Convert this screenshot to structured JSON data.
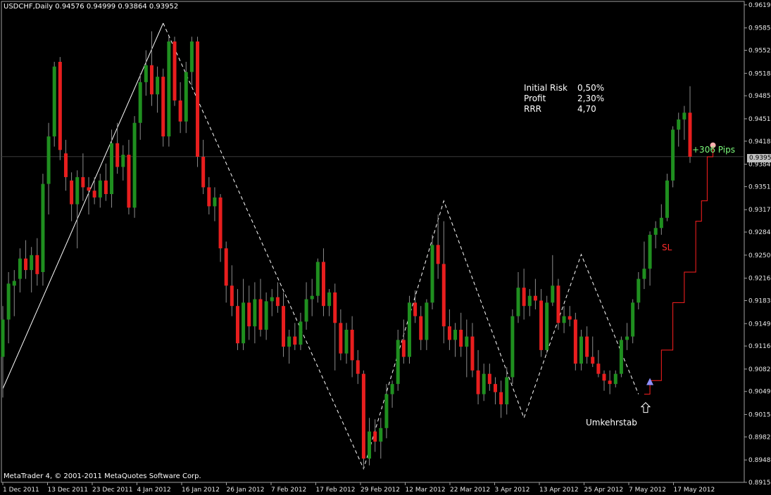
{
  "header": {
    "symbol_line": "USDCHF,Daily  0.94576 0.94999 0.93864 0.93952"
  },
  "footer": {
    "copyright": "MetaTrader 4, © 2001-2011 MetaQuotes Software Corp."
  },
  "stats": [
    {
      "label": "Initial Risk",
      "value": "0,50%"
    },
    {
      "label": "Profit",
      "value": "2,30%"
    },
    {
      "label": "RRR",
      "value": "4,70"
    }
  ],
  "annotations": {
    "pips": "+306 Pips",
    "sl": "SL",
    "reversal": "Umkehrstab"
  },
  "current_price": "0.93952",
  "colors": {
    "bull": "#1f8f1f",
    "bear": "#e81e1e",
    "wick": "#8c8c8c",
    "zigzag": "#ffffff",
    "sl_line": "#ff2020",
    "axis": "#a0a0a0"
  },
  "chart_data": {
    "type": "candlestick",
    "ylim": [
      0.8915,
      0.9622
    ],
    "y_ticks": [
      "0.96190",
      "0.95850",
      "0.95520",
      "0.95180",
      "0.94850",
      "0.94510",
      "0.94180",
      "0.93840",
      "0.93510",
      "0.93170",
      "0.92840",
      "0.92500",
      "0.92160",
      "0.91830",
      "0.91490",
      "0.91160",
      "0.90820",
      "0.90490",
      "0.90150",
      "0.89820",
      "0.89480",
      "0.89150"
    ],
    "x_ticks": [
      "1 Dec 2011",
      "13 Dec 2011",
      "23 Dec 2011",
      "4 Jan 2012",
      "16 Jan 2012",
      "26 Jan 2012",
      "7 Feb 2012",
      "17 Feb 2012",
      "29 Feb 2012",
      "12 Mar 2012",
      "22 Mar 2012",
      "3 Apr 2012",
      "13 Apr 2012",
      "25 Apr 2012",
      "7 May 2012",
      "17 May 2012"
    ],
    "candles": [
      [
        0.91,
        0.9175,
        0.904,
        0.9155
      ],
      [
        0.9155,
        0.9225,
        0.912,
        0.9208
      ],
      [
        0.9205,
        0.9228,
        0.916,
        0.9212
      ],
      [
        0.9215,
        0.926,
        0.9195,
        0.9245
      ],
      [
        0.9245,
        0.9272,
        0.9215,
        0.9228
      ],
      [
        0.9228,
        0.9262,
        0.9195,
        0.925
      ],
      [
        0.925,
        0.9275,
        0.9205,
        0.9222
      ],
      [
        0.9225,
        0.937,
        0.9205,
        0.9355
      ],
      [
        0.9355,
        0.9445,
        0.931,
        0.9425
      ],
      [
        0.9425,
        0.9535,
        0.941,
        0.9528
      ],
      [
        0.9535,
        0.9542,
        0.939,
        0.9405
      ],
      [
        0.94,
        0.942,
        0.9345,
        0.9365
      ],
      [
        0.936,
        0.9372,
        0.93,
        0.9325
      ],
      [
        0.9325,
        0.9375,
        0.926,
        0.9365
      ],
      [
        0.9365,
        0.94,
        0.933,
        0.935
      ],
      [
        0.935,
        0.9365,
        0.931,
        0.9345
      ],
      [
        0.9345,
        0.9365,
        0.9325,
        0.9335
      ],
      [
        0.9335,
        0.937,
        0.932,
        0.936
      ],
      [
        0.936,
        0.9385,
        0.933,
        0.934
      ],
      [
        0.934,
        0.9435,
        0.932,
        0.9415
      ],
      [
        0.9415,
        0.9445,
        0.937,
        0.938
      ],
      [
        0.938,
        0.9412,
        0.936,
        0.9398
      ],
      [
        0.9398,
        0.942,
        0.931,
        0.932
      ],
      [
        0.932,
        0.9455,
        0.9305,
        0.9445
      ],
      [
        0.9445,
        0.9518,
        0.942,
        0.9505
      ],
      [
        0.9505,
        0.9552,
        0.9485,
        0.953
      ],
      [
        0.953,
        0.958,
        0.947,
        0.9487
      ],
      [
        0.9487,
        0.9528,
        0.946,
        0.9513
      ],
      [
        0.9513,
        0.9525,
        0.941,
        0.9425
      ],
      [
        0.9425,
        0.9572,
        0.941,
        0.9565
      ],
      [
        0.9565,
        0.9572,
        0.947,
        0.9478
      ],
      [
        0.9478,
        0.9505,
        0.943,
        0.9447
      ],
      [
        0.9447,
        0.9535,
        0.943,
        0.952
      ],
      [
        0.952,
        0.9572,
        0.95,
        0.9565
      ],
      [
        0.9565,
        0.9572,
        0.938,
        0.9395
      ],
      [
        0.9395,
        0.942,
        0.934,
        0.935
      ],
      [
        0.935,
        0.9365,
        0.931,
        0.9322
      ],
      [
        0.9322,
        0.935,
        0.93,
        0.9335
      ],
      [
        0.9335,
        0.934,
        0.924,
        0.926
      ],
      [
        0.926,
        0.927,
        0.918,
        0.9205
      ],
      [
        0.9205,
        0.9235,
        0.916,
        0.9175
      ],
      [
        0.9175,
        0.92,
        0.911,
        0.912
      ],
      [
        0.912,
        0.9215,
        0.911,
        0.918
      ],
      [
        0.918,
        0.9205,
        0.9125,
        0.9145
      ],
      [
        0.9145,
        0.921,
        0.912,
        0.9185
      ],
      [
        0.9185,
        0.9215,
        0.913,
        0.914
      ],
      [
        0.914,
        0.9195,
        0.9125,
        0.9182
      ],
      [
        0.9182,
        0.92,
        0.916,
        0.9188
      ],
      [
        0.9188,
        0.921,
        0.9165,
        0.9175
      ],
      [
        0.9175,
        0.9195,
        0.91,
        0.9115
      ],
      [
        0.9115,
        0.914,
        0.909,
        0.913
      ],
      [
        0.913,
        0.915,
        0.911,
        0.9118
      ],
      [
        0.9118,
        0.9165,
        0.911,
        0.9152
      ],
      [
        0.9152,
        0.921,
        0.914,
        0.9185
      ],
      [
        0.9185,
        0.9215,
        0.916,
        0.919
      ],
      [
        0.919,
        0.9245,
        0.918,
        0.924
      ],
      [
        0.924,
        0.926,
        0.916,
        0.9175
      ],
      [
        0.9175,
        0.92,
        0.916,
        0.9195
      ],
      [
        0.9195,
        0.9208,
        0.908,
        0.915
      ],
      [
        0.915,
        0.917,
        0.9095,
        0.9105
      ],
      [
        0.9105,
        0.915,
        0.909,
        0.914
      ],
      [
        0.914,
        0.916,
        0.907,
        0.9095
      ],
      [
        0.9095,
        0.911,
        0.906,
        0.9075
      ],
      [
        0.9075,
        0.908,
        0.8935,
        0.895
      ],
      [
        0.895,
        0.901,
        0.894,
        0.899
      ],
      [
        0.899,
        0.9008,
        0.896,
        0.8975
      ],
      [
        0.8975,
        0.901,
        0.895,
        0.8995
      ],
      [
        0.8995,
        0.906,
        0.898,
        0.9045
      ],
      [
        0.9045,
        0.9065,
        0.9025,
        0.906
      ],
      [
        0.906,
        0.914,
        0.905,
        0.9125
      ],
      [
        0.9125,
        0.9155,
        0.909,
        0.91
      ],
      [
        0.91,
        0.919,
        0.909,
        0.918
      ],
      [
        0.918,
        0.9198,
        0.915,
        0.916
      ],
      [
        0.916,
        0.9175,
        0.911,
        0.9125
      ],
      [
        0.9125,
        0.9185,
        0.911,
        0.918
      ],
      [
        0.918,
        0.928,
        0.917,
        0.9265
      ],
      [
        0.9265,
        0.931,
        0.9215,
        0.9237
      ],
      [
        0.9237,
        0.93,
        0.912,
        0.9145
      ],
      [
        0.9145,
        0.917,
        0.911,
        0.9125
      ],
      [
        0.9125,
        0.915,
        0.91,
        0.914
      ],
      [
        0.914,
        0.9165,
        0.91,
        0.9115
      ],
      [
        0.9115,
        0.9155,
        0.907,
        0.913
      ],
      [
        0.913,
        0.915,
        0.907,
        0.908
      ],
      [
        0.908,
        0.911,
        0.903,
        0.9045
      ],
      [
        0.9045,
        0.909,
        0.9035,
        0.9075
      ],
      [
        0.9075,
        0.909,
        0.905,
        0.906
      ],
      [
        0.906,
        0.907,
        0.903,
        0.9048
      ],
      [
        0.9048,
        0.9065,
        0.901,
        0.903
      ],
      [
        0.903,
        0.9085,
        0.9015,
        0.907
      ],
      [
        0.907,
        0.917,
        0.906,
        0.916
      ],
      [
        0.916,
        0.9225,
        0.915,
        0.9202
      ],
      [
        0.9202,
        0.923,
        0.9155,
        0.9175
      ],
      [
        0.9175,
        0.92,
        0.916,
        0.919
      ],
      [
        0.919,
        0.9215,
        0.917,
        0.9183
      ],
      [
        0.9183,
        0.92,
        0.91,
        0.911
      ],
      [
        0.911,
        0.919,
        0.9105,
        0.918
      ],
      [
        0.918,
        0.925,
        0.9175,
        0.9205
      ],
      [
        0.9205,
        0.9215,
        0.914,
        0.915
      ],
      [
        0.915,
        0.9175,
        0.9135,
        0.916
      ],
      [
        0.916,
        0.9175,
        0.9145,
        0.9155
      ],
      [
        0.9155,
        0.9165,
        0.908,
        0.909
      ],
      [
        0.909,
        0.914,
        0.908,
        0.913
      ],
      [
        0.913,
        0.9145,
        0.909,
        0.91
      ],
      [
        0.91,
        0.913,
        0.9085,
        0.909
      ],
      [
        0.909,
        0.911,
        0.907,
        0.9075
      ],
      [
        0.9075,
        0.908,
        0.905,
        0.9065
      ],
      [
        0.9065,
        0.908,
        0.9045,
        0.906
      ],
      [
        0.906,
        0.908,
        0.9055,
        0.9075
      ],
      [
        0.9075,
        0.913,
        0.907,
        0.9125
      ],
      [
        0.9125,
        0.915,
        0.911,
        0.913
      ],
      [
        0.913,
        0.9185,
        0.912,
        0.918
      ],
      [
        0.918,
        0.9225,
        0.917,
        0.9215
      ],
      [
        0.9215,
        0.927,
        0.92,
        0.923
      ],
      [
        0.923,
        0.9285,
        0.9205,
        0.928
      ],
      [
        0.928,
        0.93,
        0.926,
        0.929
      ],
      [
        0.929,
        0.9325,
        0.928,
        0.9305
      ],
      [
        0.9305,
        0.937,
        0.93,
        0.936
      ],
      [
        0.936,
        0.944,
        0.935,
        0.9435
      ],
      [
        0.9435,
        0.946,
        0.941,
        0.945
      ],
      [
        0.945,
        0.947,
        0.942,
        0.946
      ],
      [
        0.946,
        0.9499,
        0.9386,
        0.9395
      ]
    ],
    "zigzag": [
      [
        0,
        0.9053
      ],
      [
        28,
        0.9592
      ],
      [
        63,
        0.8935
      ],
      [
        77,
        0.933
      ],
      [
        91,
        0.901
      ],
      [
        101,
        0.9251
      ],
      [
        111,
        0.9045
      ]
    ],
    "sl_steps": [
      [
        112,
        0.9045
      ],
      [
        113,
        0.9065
      ],
      [
        115,
        0.911
      ],
      [
        117,
        0.918
      ],
      [
        119,
        0.9225
      ],
      [
        121,
        0.93
      ],
      [
        122,
        0.933
      ],
      [
        123,
        0.9395
      ],
      [
        124,
        0.9412
      ]
    ],
    "reversal_index": 112,
    "exit_index": 124,
    "exit_price": 0.9412
  }
}
